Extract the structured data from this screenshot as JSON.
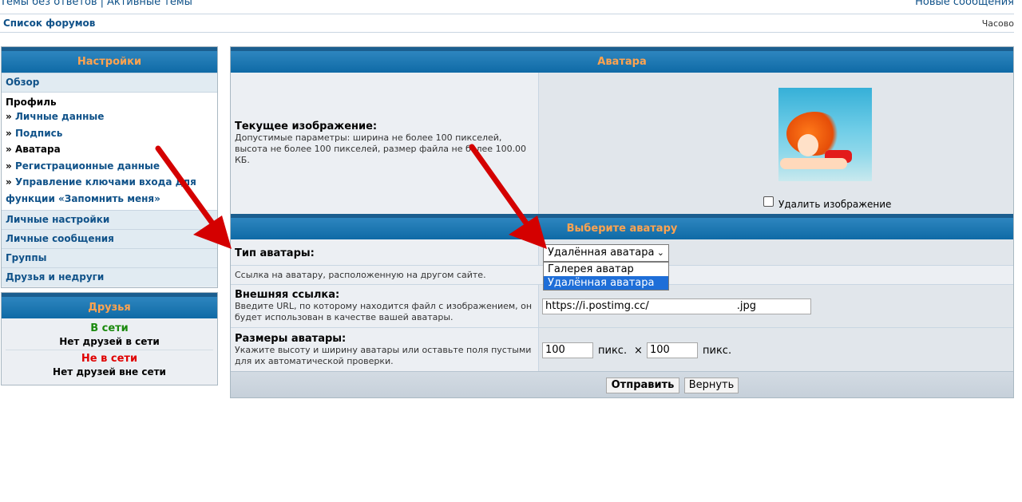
{
  "topnav": {
    "unanswered": "Темы без ответов",
    "separator": "|",
    "active": "Активные темы",
    "new_posts": "Новые сообщения"
  },
  "navbar": {
    "forums_list": "Список форумов",
    "timezone": "Часово"
  },
  "sidebar": {
    "header": "Настройки",
    "overview": "Обзор",
    "profile_label": "Профиль",
    "arrow": "»",
    "profile_items": [
      {
        "label": "Личные данные"
      },
      {
        "label": "Подпись"
      },
      {
        "label": "Аватара"
      },
      {
        "label": "Регистрационные данные"
      },
      {
        "label": "Управление ключами входа для функции «Запомнить меня»"
      }
    ],
    "sections": [
      {
        "label": "Личные настройки"
      },
      {
        "label": "Личные сообщения"
      },
      {
        "label": "Группы"
      },
      {
        "label": "Друзья и недруги"
      }
    ]
  },
  "friends": {
    "header": "Друзья",
    "online_label": "В сети",
    "online_empty": "Нет друзей в сети",
    "offline_label": "Не в сети",
    "offline_empty": "Нет друзей вне сети"
  },
  "main": {
    "header": "Аватара",
    "current_title": "Текущее изображение:",
    "current_desc": "Допустимые параметры: ширина не более 100 пикселей, высота не более 100 пикселей, размер файла не более 100.00 КБ.",
    "delete_label": "Удалить изображение",
    "choose_header": "Выберите аватару",
    "type_label": "Тип аватары:",
    "type_selected": "Удалённая аватара",
    "type_options": [
      "Галерея аватар",
      "Удалённая аватара"
    ],
    "remote_hint": "Ссылка на аватару, расположенную на другом сайте.",
    "url_title": "Внешняя ссылка:",
    "url_desc": "Введите URL, по которому находится файл с изображением, он будет использован в качестве вашей аватары.",
    "url_value_start": "https://i.postimg.cc/",
    "url_value_end": ".jpg",
    "size_title": "Размеры аватары:",
    "size_desc": "Укажите высоту и ширину аватары или оставьте поля пустыми для их автоматической проверки.",
    "width_value": "100",
    "height_value": "100",
    "px_label": "пикс.",
    "times_sign": "×",
    "submit_label": "Отправить",
    "reset_label": "Вернуть"
  },
  "colors": {
    "link": "#105289",
    "header_orange": "#ffa34f",
    "header_blue": "#0f6aa6",
    "annotation_red": "#d40000"
  }
}
